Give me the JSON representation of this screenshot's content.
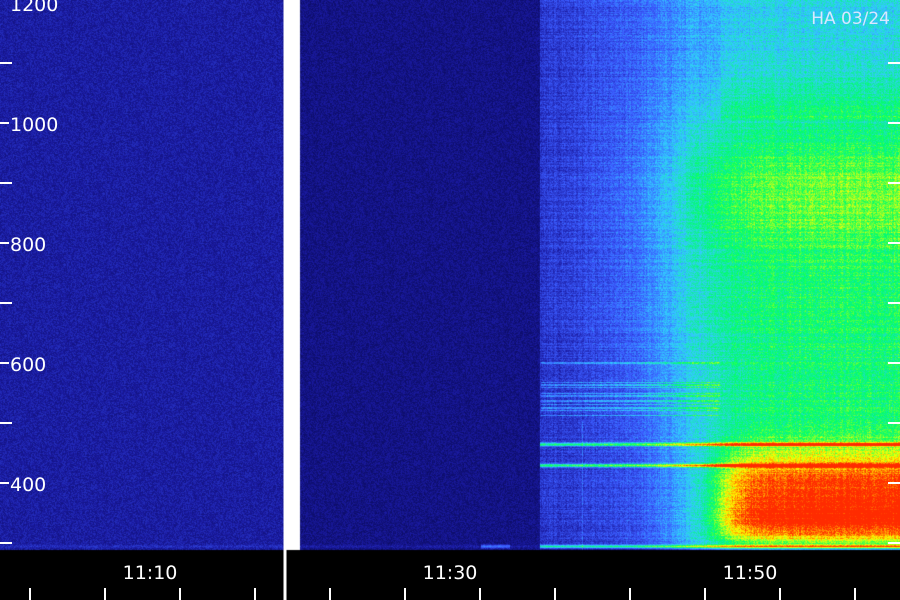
{
  "chart_data": {
    "type": "heatmap",
    "title": "",
    "date_label": "HA 03/24",
    "x_tick_labels": [
      "11:10",
      "11:30",
      "11:50"
    ],
    "y_tick_labels": [
      "400",
      "600",
      "800",
      "1000",
      "1200"
    ],
    "x_range": [
      "11:02",
      "11:52"
    ],
    "y_range": [
      290,
      1200
    ],
    "data_gap": {
      "start": "11:19",
      "end": "11:20"
    },
    "colormap": [
      "#000033",
      "#1a1aa0",
      "#3b5bff",
      "#33ccff",
      "#00ff66",
      "#ffff00",
      "#ff2a00"
    ],
    "features": [
      {
        "kind": "emission-onset",
        "time": "11:36"
      },
      {
        "kind": "bright-burst",
        "time": "11:48",
        "freq_range": [
          320,
          620
        ]
      },
      {
        "kind": "narrow-band",
        "freq": 665
      },
      {
        "kind": "narrow-band",
        "freq": 630
      },
      {
        "kind": "narrow-band",
        "freq": 495
      }
    ]
  }
}
